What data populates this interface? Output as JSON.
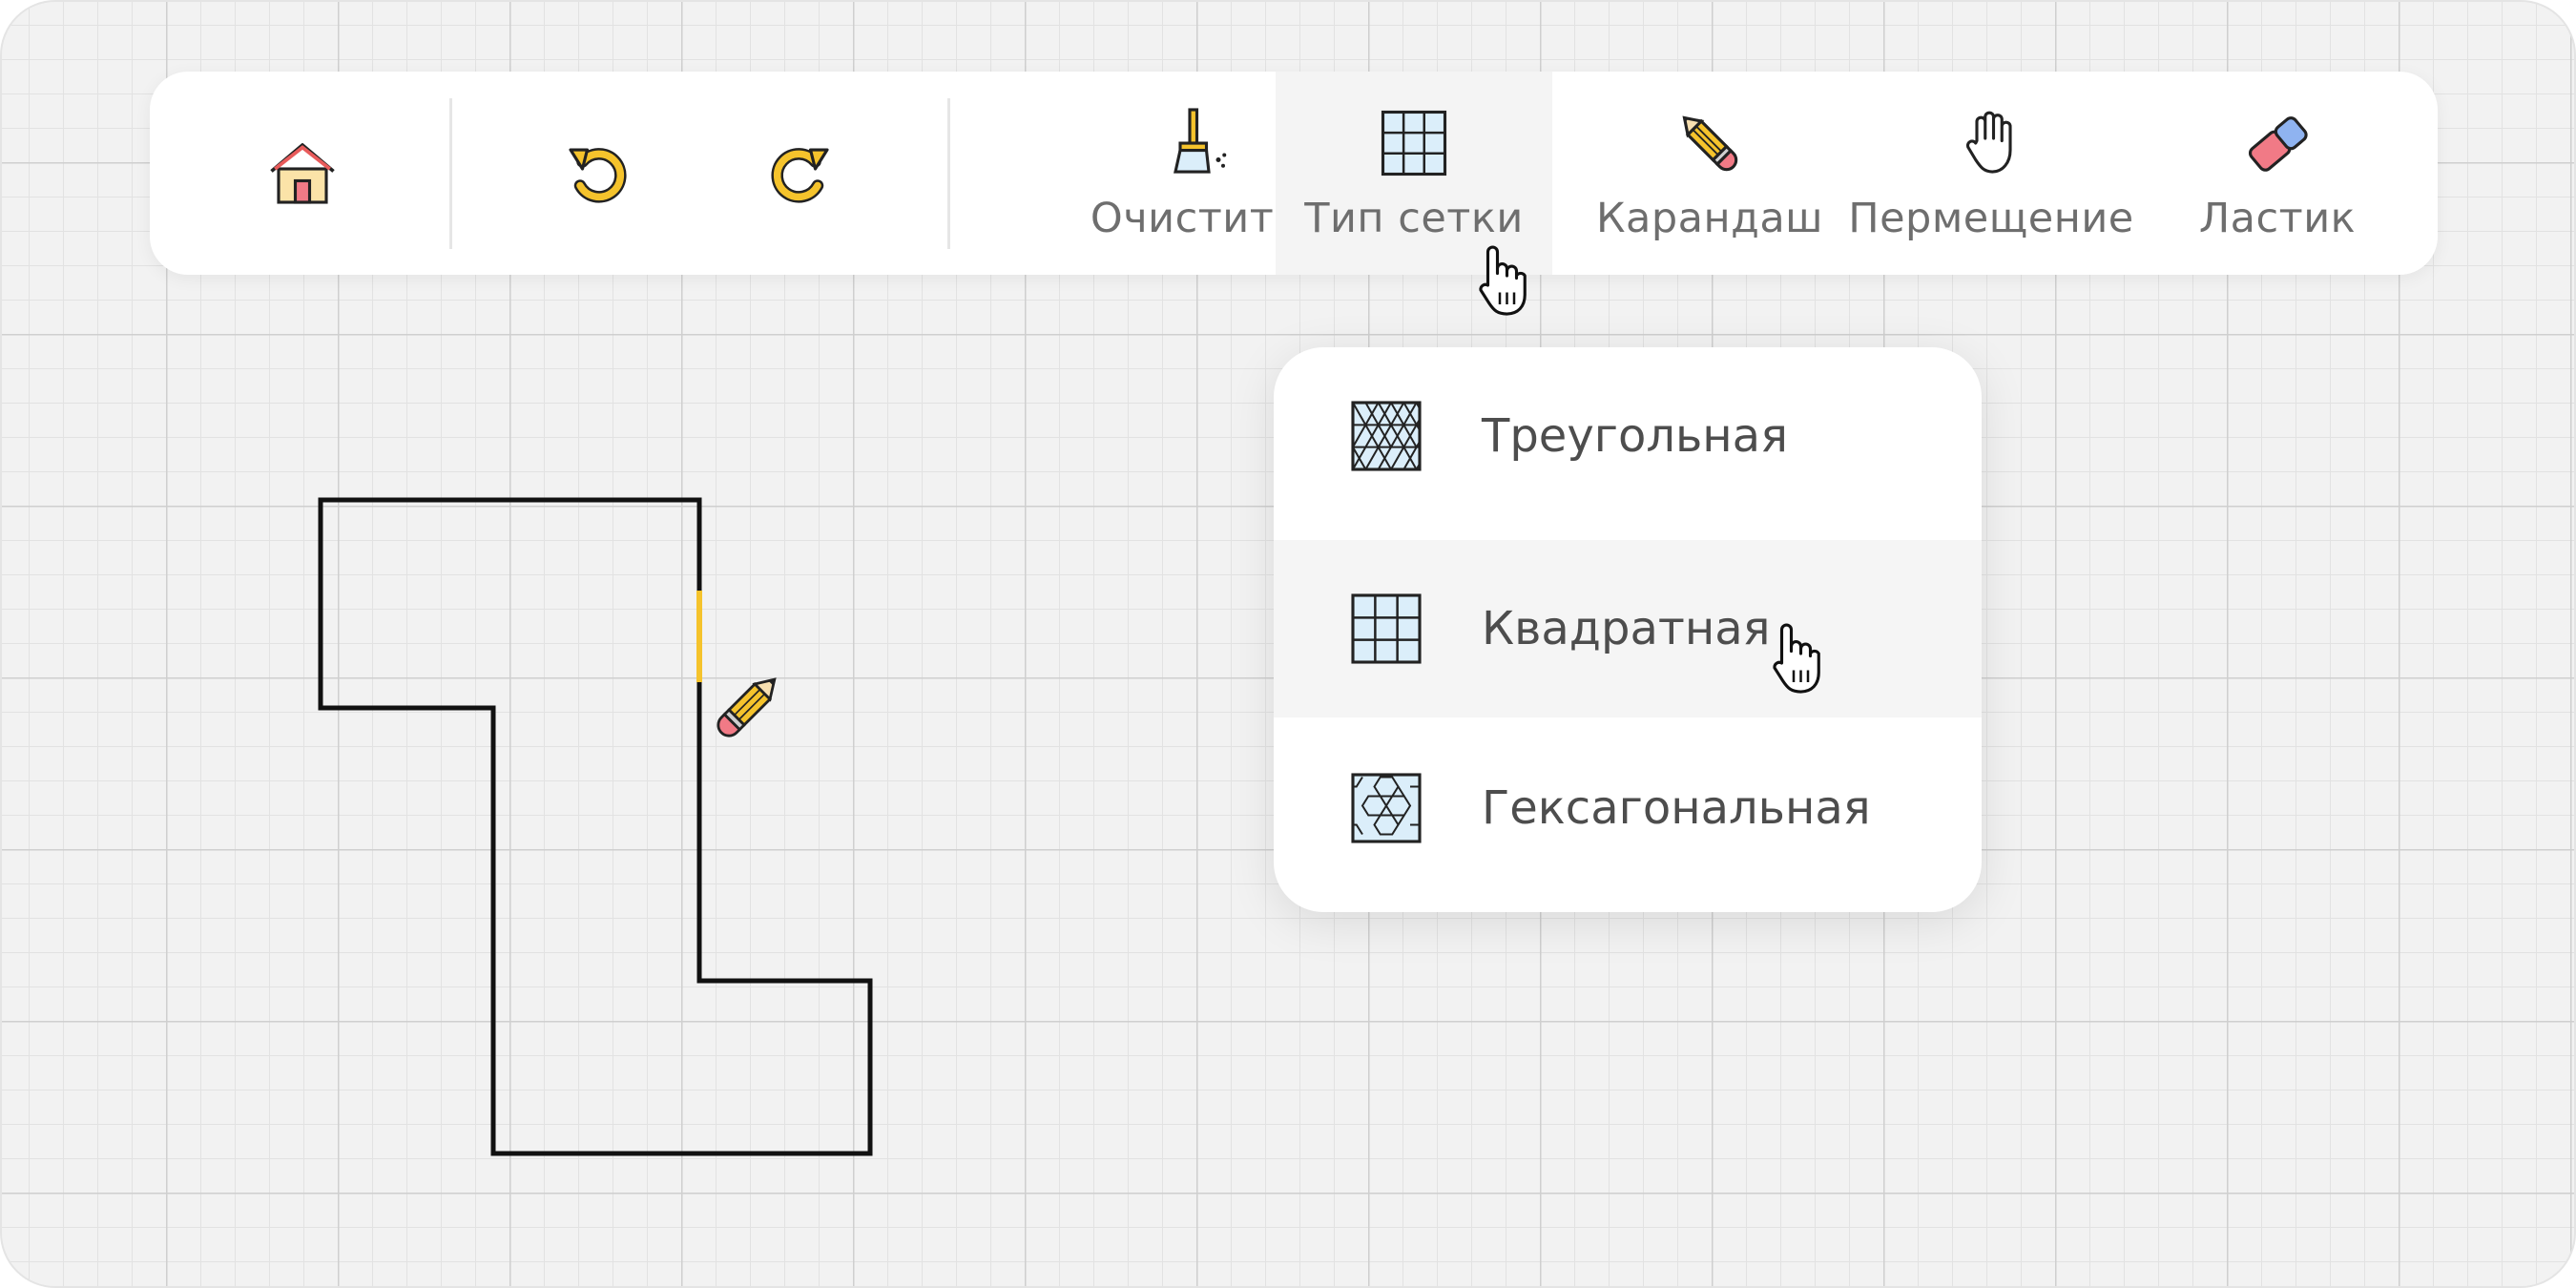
{
  "toolbar": {
    "home": {
      "icon": "home-icon"
    },
    "undo": {
      "icon": "undo-icon"
    },
    "redo": {
      "icon": "redo-icon"
    },
    "clear": {
      "label": "Очистить",
      "icon": "broom-icon"
    },
    "grid_type": {
      "label": "Тип сетки",
      "icon": "square-grid-icon",
      "active": true
    },
    "pencil": {
      "label": "Карандаш",
      "icon": "pencil-icon"
    },
    "move": {
      "label": "Пермещение",
      "icon": "hand-icon"
    },
    "eraser": {
      "label": "Ластик",
      "icon": "eraser-icon"
    }
  },
  "grid_menu": {
    "items": [
      {
        "label": "Треугольная",
        "icon": "triangle-grid-icon"
      },
      {
        "label": "Квадратная",
        "icon": "square-grid-icon",
        "hovered": true
      },
      {
        "label": "Гексагональная",
        "icon": "hexagon-grid-icon"
      }
    ]
  },
  "colors": {
    "accent_yellow": "#f5c32c",
    "stroke": "#111111",
    "icon_fill_blue": "#dbeefa",
    "eraser_pink": "#f17a86",
    "eraser_blue": "#8fb3f0"
  }
}
